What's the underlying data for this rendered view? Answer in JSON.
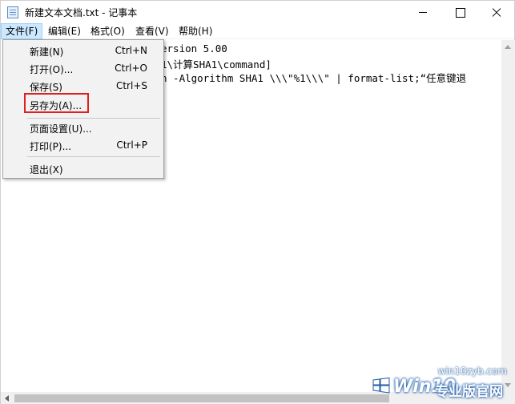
{
  "window": {
    "title": "新建文本文档.txt - 记事本"
  },
  "menubar": {
    "file": "文件(F)",
    "edit": "编辑(E)",
    "format": "格式(O)",
    "view": "查看(V)",
    "help": "帮助(H)"
  },
  "editor": {
    "lines": [
      "ersion 5.00",
      "1\\计算SHA1\\command]",
      "h -Algorithm SHA1 \\\\\\\"%1\\\\\\\" | format-list;“任意键退"
    ]
  },
  "file_menu": {
    "items": [
      {
        "label": "新建(N)",
        "shortcut": "Ctrl+N"
      },
      {
        "label": "打开(O)...",
        "shortcut": "Ctrl+O"
      },
      {
        "label": "保存(S)",
        "shortcut": "Ctrl+S"
      },
      {
        "label": "另存为(A)...",
        "shortcut": ""
      },
      {
        "label": "页面设置(U)...",
        "shortcut": ""
      },
      {
        "label": "打印(P)...",
        "shortcut": "Ctrl+P"
      },
      {
        "label": "退出(X)",
        "shortcut": ""
      }
    ],
    "highlighted_item": "另存为(A)...",
    "highlight_color": "#e02020"
  },
  "watermark": {
    "url": "win10zyb.com",
    "brand": "Win10",
    "subtitle": "专业版官网"
  },
  "colors": {
    "menu_active_bg": "#cce8ff",
    "dropdown_bg": "#f2f2f2",
    "watermark_blue": "#1c5aa8"
  }
}
